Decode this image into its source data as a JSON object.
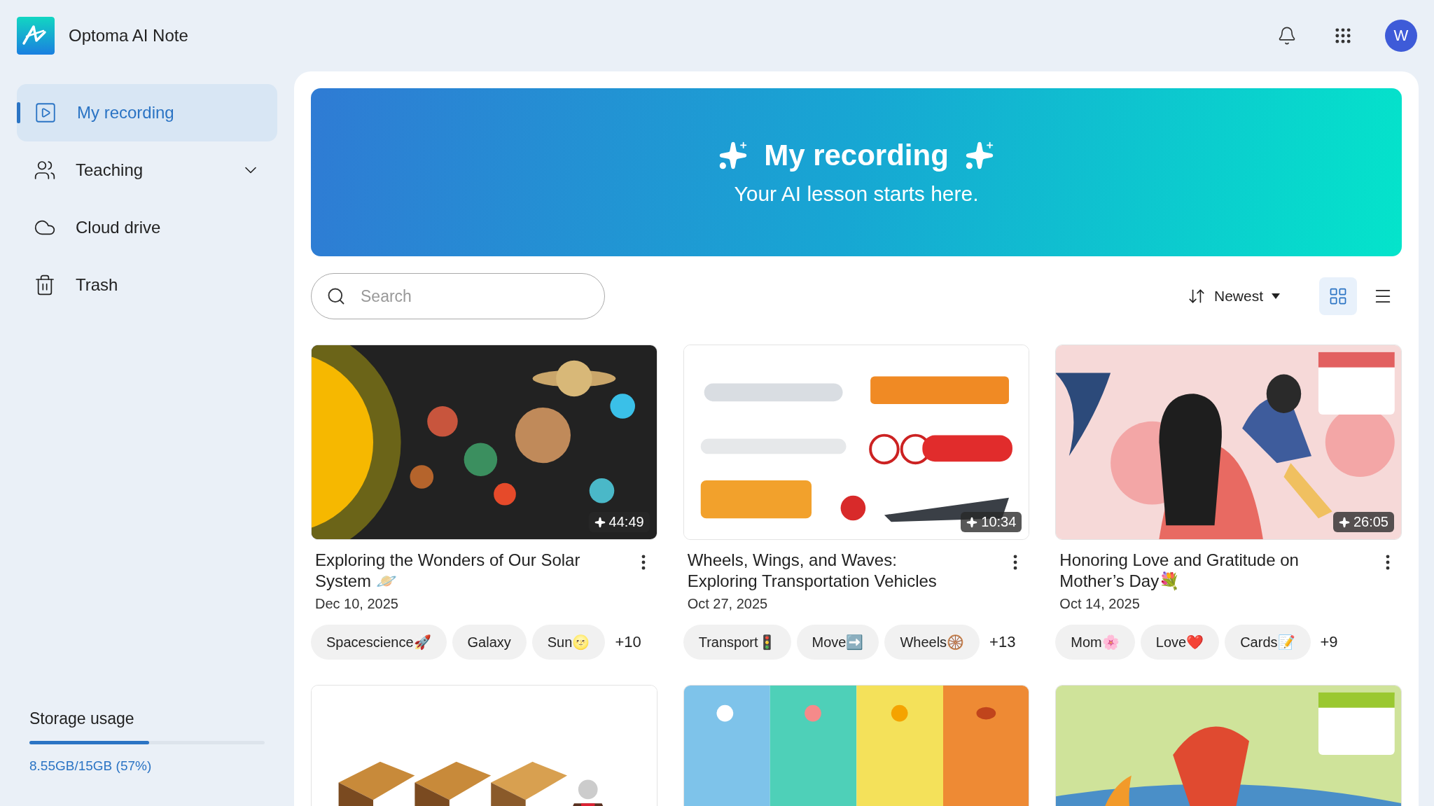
{
  "app": {
    "name": "Optoma AI Note"
  },
  "header": {
    "avatar": "W"
  },
  "sidebar": {
    "items": [
      {
        "label": "My recording",
        "selected": true
      },
      {
        "label": "Teaching",
        "selected": false,
        "expanded": false
      },
      {
        "label": "Cloud drive",
        "selected": false
      },
      {
        "label": "Trash",
        "selected": false
      }
    ],
    "storage": {
      "label": "Storage usage",
      "level": 0.51,
      "reading": "8.55GB/15GB (57%)"
    }
  },
  "banner": {
    "title": "My recording",
    "subtitle": "Your AI lesson starts here."
  },
  "toolbar": {
    "search": {
      "placeholder": "Search"
    },
    "sort": "Newest",
    "views": [
      {
        "kind": "grid",
        "selected": true
      },
      {
        "kind": "list",
        "selected": false
      }
    ]
  },
  "cards": [
    {
      "thumbnail": {
        "kind": "picture"
      },
      "duration": "44:49",
      "title": "Exploring the Wonders of Our Solar System 🪐",
      "date": "Dec 10, 2025",
      "tags": [
        "Spacescience🚀",
        "Galaxy",
        "Sun🌝"
      ],
      "more_tags": "+10"
    },
    {
      "thumbnail": {
        "kind": "picture"
      },
      "duration": "10:34",
      "title": "Wheels, Wings, and Waves: Exploring Transportation Vehicles",
      "date": "Oct 27, 2025",
      "tags": [
        "Transport🚦",
        "Move➡️",
        "Wheels🛞"
      ],
      "more_tags": "+13"
    },
    {
      "thumbnail": {
        "kind": "picture"
      },
      "duration": "26:05",
      "title": "Honoring Love and Gratitude on Mother’s Day💐",
      "date": "Oct 14, 2025",
      "tags": [
        "Mom🌸",
        "Love❤️",
        "Cards📝"
      ],
      "more_tags": "+9"
    },
    {
      "thumbnail": {
        "kind": "picture"
      }
    },
    {
      "thumbnail": {
        "kind": "picture"
      }
    },
    {
      "thumbnail": {
        "kind": "picture"
      }
    }
  ]
}
